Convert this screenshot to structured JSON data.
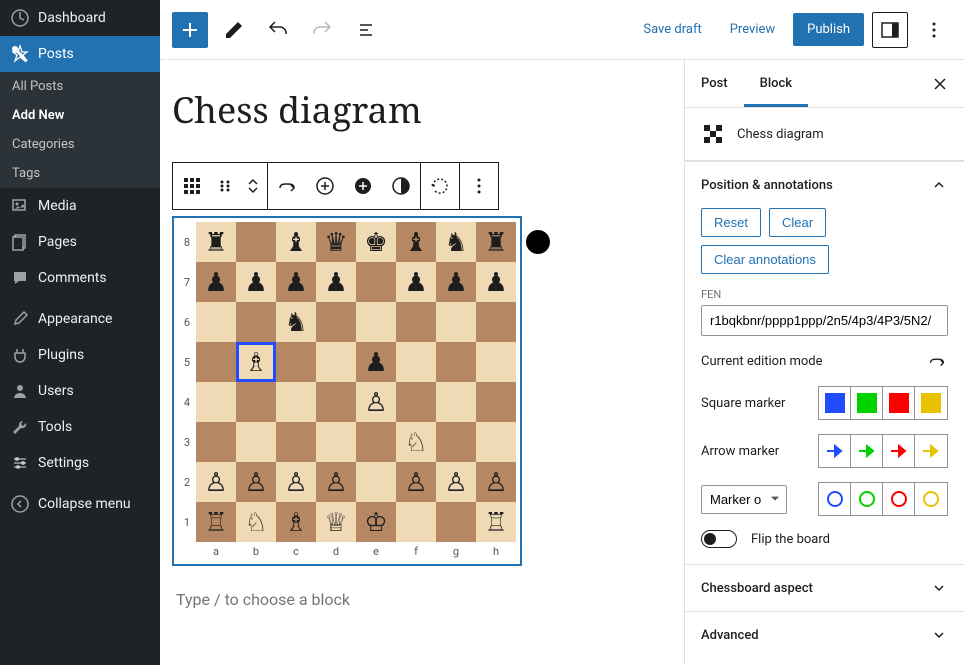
{
  "sidebar": {
    "dashboard": "Dashboard",
    "posts": "Posts",
    "posts_sub": [
      "All Posts",
      "Add New",
      "Categories",
      "Tags"
    ],
    "media": "Media",
    "pages": "Pages",
    "comments": "Comments",
    "appearance": "Appearance",
    "plugins": "Plugins",
    "users": "Users",
    "tools": "Tools",
    "settings": "Settings",
    "collapse": "Collapse menu"
  },
  "topbar": {
    "save_draft": "Save draft",
    "preview": "Preview",
    "publish": "Publish"
  },
  "editor": {
    "title": "Chess diagram",
    "placeholder": "Type / to choose a block"
  },
  "inspector": {
    "tab_post": "Post",
    "tab_block": "Block",
    "block_name": "Chess diagram",
    "panel_pos": "Position & annotations",
    "reset": "Reset",
    "clear": "Clear",
    "clear_ann": "Clear annotations",
    "fen_label": "FEN",
    "fen_value": "r1bqkbnr/pppp1ppp/2n5/4p3/4P3/5N2/",
    "edition_mode": "Current edition mode",
    "square_marker": "Square marker",
    "arrow_marker": "Arrow marker",
    "marker_select": "Marker o",
    "flip": "Flip the board",
    "panel_aspect": "Chessboard aspect",
    "panel_adv": "Advanced",
    "colors": {
      "blue": "#1f4dff",
      "green": "#00d200",
      "red": "#ff0000",
      "yellow": "#e6c200"
    }
  },
  "board": {
    "files": [
      "a",
      "b",
      "c",
      "d",
      "e",
      "f",
      "g",
      "h"
    ],
    "ranks": [
      "8",
      "7",
      "6",
      "5",
      "4",
      "3",
      "2",
      "1"
    ],
    "highlight": "b5",
    "turn": "black",
    "position": [
      [
        "♜",
        "",
        "♝",
        "♛",
        "♚",
        "♝",
        "♞",
        "♜"
      ],
      [
        "♟",
        "♟",
        "♟",
        "♟",
        "",
        "♟",
        "♟",
        "♟"
      ],
      [
        "",
        "",
        "♞",
        "",
        "",
        "",
        "",
        ""
      ],
      [
        "",
        "♗",
        "",
        "",
        "♟",
        "",
        "",
        ""
      ],
      [
        "",
        "",
        "",
        "",
        "♙",
        "",
        "",
        ""
      ],
      [
        "",
        "",
        "",
        "",
        "",
        "♘",
        "",
        ""
      ],
      [
        "♙",
        "♙",
        "♙",
        "♙",
        "",
        "♙",
        "♙",
        "♙"
      ],
      [
        "♖",
        "♘",
        "♗",
        "♕",
        "♔",
        "",
        "",
        "♖"
      ]
    ]
  }
}
